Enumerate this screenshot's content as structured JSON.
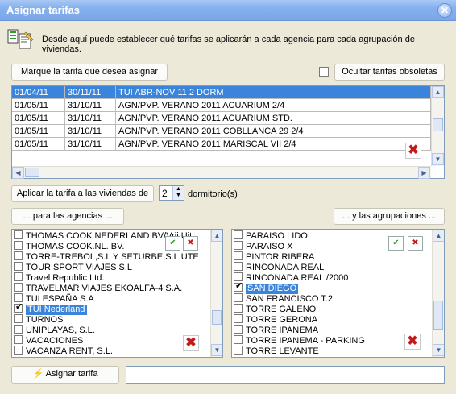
{
  "window": {
    "title": "Asignar tarifas",
    "close_glyph": "✕"
  },
  "info": {
    "icon": "document-checklist-icon",
    "text": "Desde aquí puede establecer qué tarifas se aplicarán a cada agencia para cada agrupación de viviendas."
  },
  "tariff_section": {
    "select_label": "Marque la tarifa que desea asignar",
    "hide_obsolete_label": "Ocultar tarifas obsoletas",
    "hide_obsolete_checked": false,
    "rows": [
      {
        "from": "01/04/11",
        "to": "30/11/11",
        "name": "TUI ABR-NOV 11 2 DORM",
        "selected": true
      },
      {
        "from": "01/05/11",
        "to": "31/10/11",
        "name": "AGN/PVP. VERANO 2011  ACUARIUM 2/4",
        "selected": false
      },
      {
        "from": "01/05/11",
        "to": "31/10/11",
        "name": "AGN/PVP. VERANO 2011 ACUARIUM STD.",
        "selected": false
      },
      {
        "from": "01/05/11",
        "to": "31/10/11",
        "name": "AGN/PVP. VERANO 2011 COBLLANCA 29  2/4",
        "selected": false
      },
      {
        "from": "01/05/11",
        "to": "31/10/11",
        "name": "AGN/PVP. VERANO 2011 MARISCAL VII 2/4",
        "selected": false
      }
    ]
  },
  "apply": {
    "label": "Aplicar la tarifa a las viviendas de",
    "bedrooms": "2",
    "suffix": "dormitorio(s)"
  },
  "agencies": {
    "button_label": "... para las agencias ...",
    "items": [
      {
        "label": "THOMAS COOK NEDERLAND BV/Vrij Uit",
        "checked": false,
        "selected": false
      },
      {
        "label": "THOMAS COOK.NL. BV.",
        "checked": false,
        "selected": false
      },
      {
        "label": "TORRE-TREBOL,S.L Y SETURBE,S.L.UTE",
        "checked": false,
        "selected": false
      },
      {
        "label": "TOUR SPORT VIAJES S.L",
        "checked": false,
        "selected": false
      },
      {
        "label": "Travel Republic Ltd.",
        "checked": false,
        "selected": false
      },
      {
        "label": "TRAVELMAR VIAJES EKOALFA-4 S.A.",
        "checked": false,
        "selected": false
      },
      {
        "label": "TUI ESPAÑA S.A",
        "checked": false,
        "selected": false
      },
      {
        "label": "TUI Nederland",
        "checked": true,
        "selected": true
      },
      {
        "label": "TURNOS",
        "checked": false,
        "selected": false
      },
      {
        "label": "UNIPLAYAS, S.L.",
        "checked": false,
        "selected": false
      },
      {
        "label": "VACACIONES",
        "checked": false,
        "selected": false
      },
      {
        "label": "VACANZA RENT, S.L.",
        "checked": false,
        "selected": false
      }
    ]
  },
  "groupings": {
    "button_label": "... y las agrupaciones ...",
    "items": [
      {
        "label": "PARAISO LIDO",
        "checked": false,
        "selected": false
      },
      {
        "label": "PARAISO X",
        "checked": false,
        "selected": false
      },
      {
        "label": "PINTOR RIBERA",
        "checked": false,
        "selected": false
      },
      {
        "label": "RINCONADA REAL",
        "checked": false,
        "selected": false
      },
      {
        "label": "RINCONADA REAL /2000",
        "checked": false,
        "selected": false
      },
      {
        "label": "SAN DIEGO",
        "checked": true,
        "selected": true
      },
      {
        "label": "SAN FRANCISCO T.2",
        "checked": false,
        "selected": false
      },
      {
        "label": "TORRE GALENO",
        "checked": false,
        "selected": false
      },
      {
        "label": "TORRE GERONA",
        "checked": false,
        "selected": false
      },
      {
        "label": "TORRE IPANEMA",
        "checked": false,
        "selected": false
      },
      {
        "label": "TORRE IPANEMA - PARKING",
        "checked": false,
        "selected": false
      },
      {
        "label": "TORRE LEVANTE",
        "checked": false,
        "selected": false
      }
    ]
  },
  "footer": {
    "assign_label": "Asignar tarifa",
    "assign_icon": "lightning-icon",
    "status_text": ""
  },
  "colors": {
    "selection": "#3b84dc",
    "delete": "#c21b1b",
    "title_bar": "#7aa6ea"
  }
}
